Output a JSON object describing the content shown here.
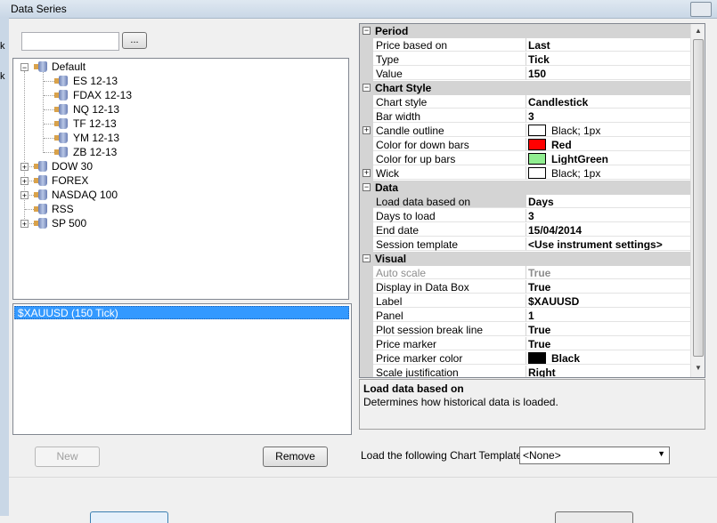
{
  "window": {
    "title": "Data Series"
  },
  "left_strip_chars": [
    "k",
    "k"
  ],
  "instrument_search": {
    "value": "",
    "button_label": "..."
  },
  "tree": {
    "default_group": {
      "label": "Default",
      "children": [
        "ES 12-13",
        "FDAX 12-13",
        "NQ 12-13",
        "TF 12-13",
        "YM 12-13",
        "ZB 12-13"
      ]
    },
    "groups": [
      "DOW 30",
      "FOREX",
      "NASDAQ 100",
      "RSS",
      "SP 500"
    ]
  },
  "series_list": {
    "items": [
      "$XAUUSD (150 Tick)"
    ]
  },
  "buttons": {
    "new": "New",
    "remove": "Remove"
  },
  "properties": {
    "period": {
      "title": "Period",
      "rows": [
        {
          "name": "Price based on",
          "value": "Last"
        },
        {
          "name": "Type",
          "value": "Tick"
        },
        {
          "name": "Value",
          "value": "150"
        }
      ]
    },
    "chart_style": {
      "title": "Chart Style",
      "rows": [
        {
          "name": "Chart style",
          "value": "Candlestick"
        },
        {
          "name": "Bar width",
          "value": "3"
        },
        {
          "name": "Candle outline",
          "value": "Black; 1px",
          "swatch": "#ffffff",
          "expandable": true
        },
        {
          "name": "Color for down bars",
          "value": "Red",
          "swatch": "#ff0000"
        },
        {
          "name": "Color for up bars",
          "value": "LightGreen",
          "swatch": "#90ee90"
        },
        {
          "name": "Wick",
          "value": "Black; 1px",
          "swatch": "#ffffff",
          "expandable": true
        }
      ]
    },
    "data": {
      "title": "Data",
      "rows": [
        {
          "name": "Load data based on",
          "value": "Days",
          "selected": true
        },
        {
          "name": "Days to load",
          "value": "3"
        },
        {
          "name": "End date",
          "value": "15/04/2014"
        },
        {
          "name": "Session template",
          "value": "<Use instrument settings>"
        }
      ]
    },
    "visual": {
      "title": "Visual",
      "rows": [
        {
          "name": "Auto scale",
          "value": "True",
          "disabled": true
        },
        {
          "name": "Display in Data Box",
          "value": "True"
        },
        {
          "name": "Label",
          "value": "$XAUUSD"
        },
        {
          "name": "Panel",
          "value": "1"
        },
        {
          "name": "Plot session break line",
          "value": "True"
        },
        {
          "name": "Price marker",
          "value": "True"
        },
        {
          "name": "Price marker color",
          "value": "Black",
          "swatch": "#000000"
        },
        {
          "name": "Scale justification",
          "value": "Right"
        }
      ]
    }
  },
  "description": {
    "title": "Load data based on",
    "text": "Determines how historical data is loaded."
  },
  "chart_template": {
    "label": "Load the following Chart Template:",
    "selected": "<None>"
  }
}
